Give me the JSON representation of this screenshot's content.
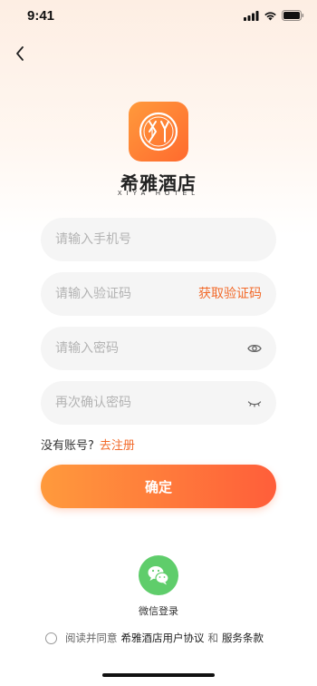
{
  "status_bar": {
    "time": "9:41",
    "icons": [
      "cellular-icon",
      "wifi-icon",
      "battery-icon"
    ]
  },
  "nav": {
    "back_icon": "chevron-left-icon"
  },
  "brand": {
    "name": "希雅酒店",
    "name_en": "XIYA HOTEL",
    "logo_mark": "XY",
    "accent_from": "#ff9a3c",
    "accent_to": "#ff5e3a"
  },
  "form": {
    "phone_placeholder": "请输入手机号",
    "code_placeholder": "请输入验证码",
    "get_code_label": "获取验证码",
    "password_placeholder": "请输入密码",
    "confirm_password_placeholder": "再次确认密码",
    "password_icon": "eye-open-icon",
    "confirm_password_icon": "eye-closed-icon"
  },
  "register": {
    "prompt": "没有账号?",
    "link": "去注册"
  },
  "confirm_label": "确定",
  "wechat": {
    "icon": "wechat-icon",
    "label": "微信登录"
  },
  "agreement": {
    "prefix": "阅读并同意",
    "user_agreement": "希雅酒店用户协议",
    "and": "和",
    "terms": "服务条款"
  },
  "colors": {
    "accent": "#f26a2a",
    "wechat": "#5fcd6b",
    "field_bg": "#f5f5f5"
  }
}
